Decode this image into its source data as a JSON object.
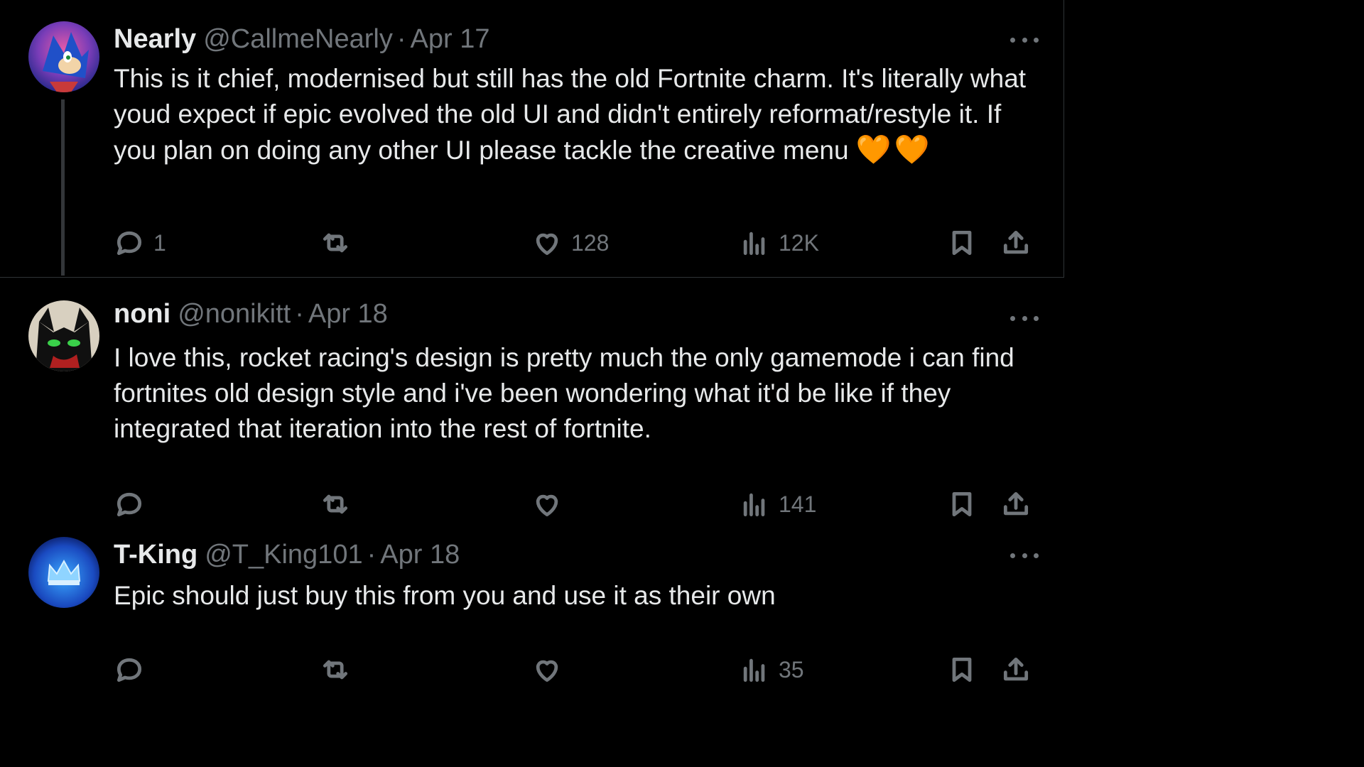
{
  "tweets": [
    {
      "name": "Nearly",
      "handle": "@CallmeNearly",
      "separator": "·",
      "date": "Apr 17",
      "text": "This is it chief, modernised but still has the old Fortnite charm. It's literally what youd expect if epic evolved the old UI and didn't entirely reformat/restyle it. If you plan on doing any other UI please tackle the creative menu",
      "emoji": "🧡🧡",
      "replies": "1",
      "retweets": "",
      "likes": "128",
      "views": "12K",
      "avatar_icon": "sonic-avatar-icon"
    },
    {
      "name": "noni",
      "handle": "@nonikitt",
      "separator": "·",
      "date": "Apr 18",
      "text": "I love this, rocket racing's design is pretty much the only gamemode i can find fortnites old design style and i've been wondering what it'd be like if they integrated that iteration into the rest of fortnite.",
      "emoji": "",
      "replies": "",
      "retweets": "",
      "likes": "",
      "views": "141",
      "avatar_icon": "cat-avatar-icon"
    },
    {
      "name": "T-King",
      "handle": "@T_King101",
      "separator": "·",
      "date": "Apr 18",
      "text": "Epic should just buy this from you and use it as their own",
      "emoji": "",
      "replies": "",
      "retweets": "",
      "likes": "",
      "views": "35",
      "avatar_icon": "crown-avatar-icon"
    }
  ],
  "colors": {
    "background": "#000000",
    "text": "#e7e9ea",
    "muted": "#71767b",
    "border": "#2f3336",
    "heart_emoji": "#f28c0f"
  }
}
